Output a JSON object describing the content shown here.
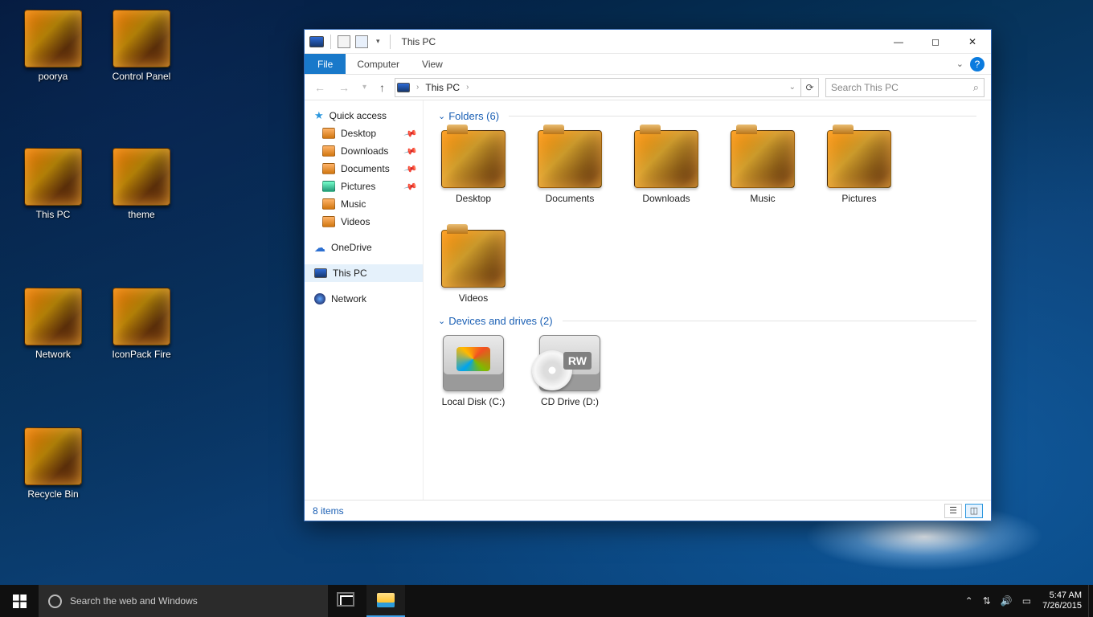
{
  "desktop_icons": [
    {
      "id": "poorya",
      "label": "poorya"
    },
    {
      "id": "controlpanel",
      "label": "Control Panel"
    },
    {
      "id": "thispc",
      "label": "This PC"
    },
    {
      "id": "theme",
      "label": "theme"
    },
    {
      "id": "network",
      "label": "Network"
    },
    {
      "id": "iconpack",
      "label": "IconPack Fire"
    },
    {
      "id": "recyclebin",
      "label": "Recycle Bin"
    }
  ],
  "explorer": {
    "title": "This PC",
    "ribbon": {
      "file": "File",
      "tabs": [
        "Computer",
        "View"
      ]
    },
    "address": {
      "crumb": "This PC"
    },
    "search": {
      "placeholder": "Search This PC"
    },
    "nav": {
      "quick_access": "Quick access",
      "quick_items": [
        "Desktop",
        "Downloads",
        "Documents",
        "Pictures",
        "Music",
        "Videos"
      ],
      "onedrive": "OneDrive",
      "thispc": "This PC",
      "network": "Network"
    },
    "groups": {
      "folders": {
        "header": "Folders (6)",
        "items": [
          "Desktop",
          "Documents",
          "Downloads",
          "Music",
          "Pictures",
          "Videos"
        ]
      },
      "devices": {
        "header": "Devices and drives (2)",
        "items": [
          "Local Disk (C:)",
          "CD Drive (D:)"
        ]
      }
    },
    "status": "8 items"
  },
  "taskbar": {
    "search_placeholder": "Search the web and Windows",
    "time": "5:47 AM",
    "date": "7/26/2015"
  }
}
